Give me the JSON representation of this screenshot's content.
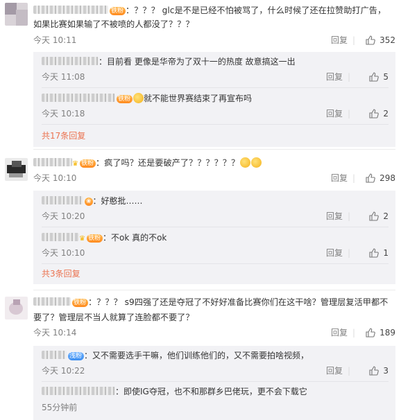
{
  "comments": [
    {
      "badge": "铁粉",
      "text": "：？？？ glc是不是已经不怕被骂了，什么时候了还在拉赞助打广告，",
      "text2": "如果比赛如果输了不被喷的人都没了？？？",
      "time": "今天 10:11",
      "reply_label": "回复",
      "likes": "352",
      "replies": [
        {
          "text": "：目前看 更像是华帝为了双十一的热度 故意搞这一出",
          "time": "今天 11:08",
          "reply_label": "回复",
          "likes": "5"
        },
        {
          "badge": "铁粉",
          "text": "就不能世界赛结束了再宣布吗",
          "time": "今天 10:18",
          "reply_label": "回复",
          "likes": "2"
        }
      ],
      "more": "共17条回复"
    },
    {
      "badge": "铁粉",
      "text": "：疯了吗？还是要破产了？？？？？？",
      "time": "今天 10:10",
      "reply_label": "回复",
      "likes": "298",
      "replies": [
        {
          "text": "：好憨批……",
          "time": "今天 10:20",
          "reply_label": "回复",
          "likes": "2"
        },
        {
          "badge": "铁粉",
          "text": "：不ok 真的不ok",
          "time": "今天 10:10",
          "reply_label": "回复",
          "likes": "1"
        }
      ],
      "more": "共3条回复"
    },
    {
      "badge": "铁粉",
      "text": "：？？？ s9四强了还是夺冠了不好好准备比赛你们在这干啥？管理层复活甲都不",
      "text2": "要了？管理层不当人就算了连脸都不要了？",
      "time": "今天 10:14",
      "reply_label": "回复",
      "likes": "189",
      "replies": [
        {
          "badge": "浅粉",
          "text": "：又不需要选手干嘛，他们训练他们的，又不需要拍啥视频，",
          "time": "今天 10:22",
          "reply_label": "回复",
          "likes": "3"
        },
        {
          "text": "：即使IG夺冠，也不和那群乡巴佬玩，更不会下载它",
          "time": "55分钟前"
        }
      ]
    }
  ]
}
